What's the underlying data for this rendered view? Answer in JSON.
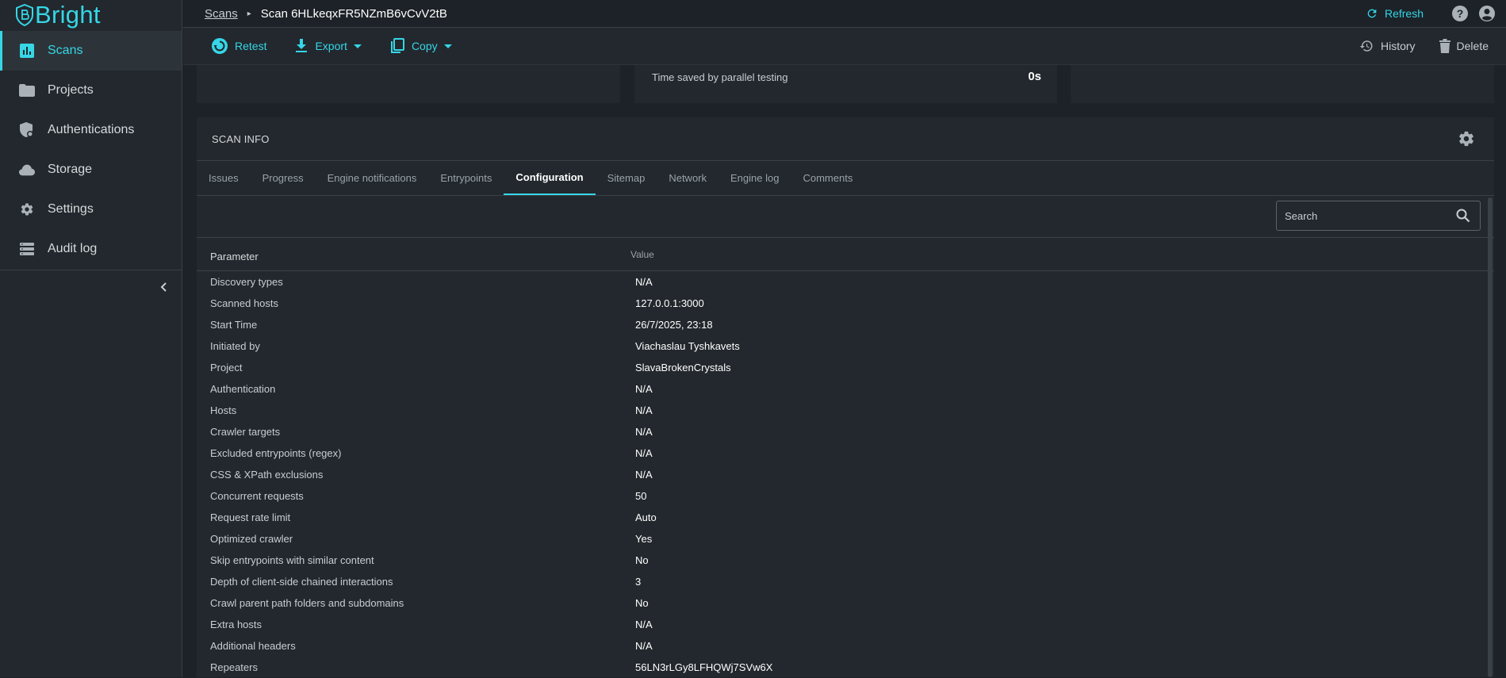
{
  "app": {
    "logo_text": "Bright",
    "accent_color": "#36d6e7"
  },
  "sidebar": {
    "items": [
      {
        "label": "Scans",
        "icon": "chart-icon"
      },
      {
        "label": "Projects",
        "icon": "folder-icon"
      },
      {
        "label": "Authentications",
        "icon": "auth-icon"
      },
      {
        "label": "Storage",
        "icon": "cloud-icon"
      },
      {
        "label": "Settings",
        "icon": "gear-icon"
      },
      {
        "label": "Audit log",
        "icon": "list-icon"
      }
    ],
    "active": "Scans"
  },
  "header": {
    "breadcrumb_root": "Scans",
    "breadcrumb_current": "Scan 6HLkeqxFR5NZmB6vCvV2tB",
    "refresh_label": "Refresh"
  },
  "toolbar": {
    "retest_label": "Retest",
    "export_label": "Export",
    "copy_label": "Copy",
    "history_label": "History",
    "delete_label": "Delete"
  },
  "cards": {
    "time_saved_label": "Time saved by parallel testing",
    "time_saved_value": "0s"
  },
  "scan_info": {
    "title": "SCAN INFO",
    "tabs": [
      "Issues",
      "Progress",
      "Engine notifications",
      "Entrypoints",
      "Configuration",
      "Sitemap",
      "Network",
      "Engine log",
      "Comments"
    ],
    "active_tab": "Configuration",
    "search_placeholder": "Search",
    "columns": {
      "parameter": "Parameter",
      "value": "Value"
    },
    "rows": [
      {
        "parameter": "Discovery types",
        "value": "N/A"
      },
      {
        "parameter": "Scanned hosts",
        "value": "127.0.0.1:3000"
      },
      {
        "parameter": "Start Time",
        "value": "26/7/2025, 23:18"
      },
      {
        "parameter": "Initiated by",
        "value": "Viachaslau Tyshkavets"
      },
      {
        "parameter": "Project",
        "value": "SlavaBrokenCrystals"
      },
      {
        "parameter": "Authentication",
        "value": "N/A"
      },
      {
        "parameter": "Hosts",
        "value": "N/A"
      },
      {
        "parameter": "Crawler targets",
        "value": "N/A"
      },
      {
        "parameter": "Excluded entrypoints (regex)",
        "value": "N/A"
      },
      {
        "parameter": "CSS & XPath exclusions",
        "value": "N/A"
      },
      {
        "parameter": "Concurrent requests",
        "value": "50"
      },
      {
        "parameter": "Request rate limit",
        "value": "Auto"
      },
      {
        "parameter": "Optimized crawler",
        "value": "Yes"
      },
      {
        "parameter": "Skip entrypoints with similar content",
        "value": "No"
      },
      {
        "parameter": "Depth of client-side chained interactions",
        "value": "3"
      },
      {
        "parameter": "Crawl parent path folders and subdomains",
        "value": "No"
      },
      {
        "parameter": "Extra hosts",
        "value": "N/A"
      },
      {
        "parameter": "Additional headers",
        "value": "N/A"
      },
      {
        "parameter": "Repeaters",
        "value": "56LN3rLGy8LFHQWj7SVw6X"
      }
    ]
  }
}
